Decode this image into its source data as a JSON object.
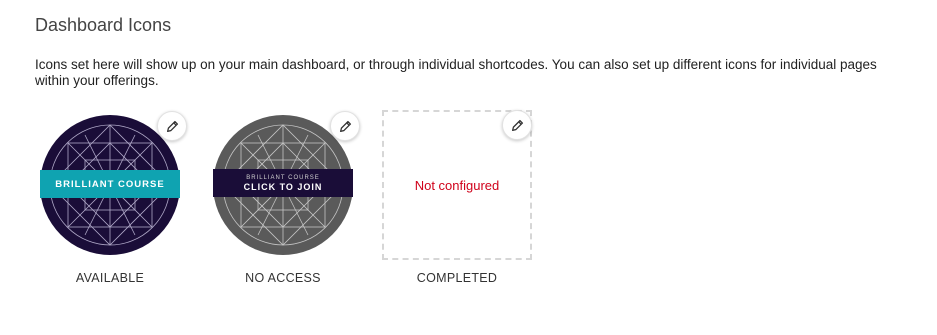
{
  "section": {
    "title": "Dashboard Icons",
    "description": "Icons set here will show up on your main dashboard, or through individual shortcodes. You can also set up different icons for individual pages within your offerings."
  },
  "icons": [
    {
      "label": "AVAILABLE",
      "banner": "BRILLIANT COURSE",
      "banner_color": "#0fa3b1",
      "circle_color": "#1a0d38",
      "edit_icon": "pencil-icon"
    },
    {
      "label": "NO ACCESS",
      "banner_small": "BRILLIANT COURSE",
      "banner": "CLICK TO JOIN",
      "banner_color": "#1a0d38",
      "circle_color": "#5a5a5a",
      "edit_icon": "pencil-icon"
    },
    {
      "label": "COMPLETED",
      "placeholder": "Not configured",
      "placeholder_color": "#d0021b",
      "edit_icon": "pencil-icon"
    }
  ]
}
